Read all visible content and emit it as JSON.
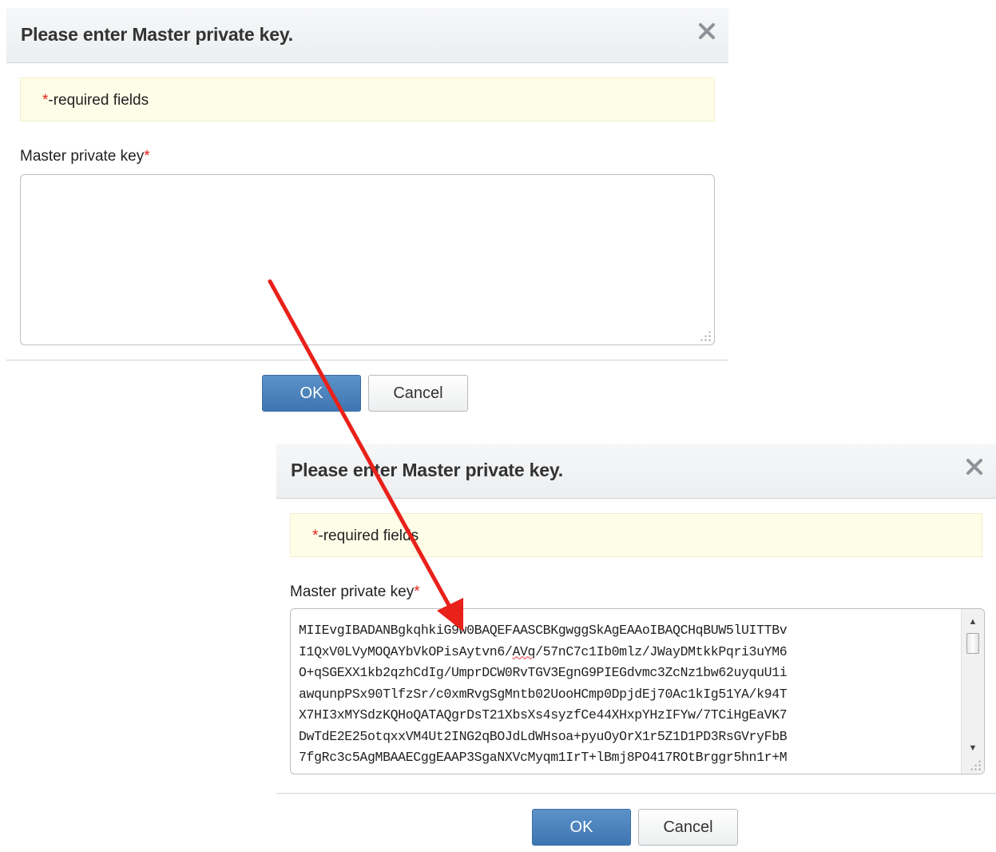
{
  "dialog_top": {
    "title": "Please enter Master private key.",
    "required_star": "*",
    "required_text": "-required fields",
    "field_label": "Master private key",
    "field_star": "*",
    "key_value": "",
    "ok_label": "OK",
    "cancel_label": "Cancel",
    "close_icon": "close-icon"
  },
  "dialog_bottom": {
    "title": "Please enter Master private key.",
    "required_star": "*",
    "required_text": "-required fields",
    "field_label": "Master private key",
    "field_star": "*",
    "key_lines": [
      "MIIEvgIBADANBgkqhkiG9w0BAQEFAASCBKgwggSkAgEAAoIBAQCHqBUW5lUITTBv",
      "I1QxV0LVyMOQAYbVkOPisAytvn6/",
      "AVq",
      "/57nC7c1Ib0mlz/JWayDMtkkPqri3uYM6",
      "O+qSGEXX1kb2qzhCdIg/UmprDCW0RvTGV3EgnG9PIEGdvmc3ZcNz1bw62uyquU1i",
      "awqunpPSx90TlfzSr/c0xmRvgSgMntb02UooHCmp0DpjdEj70Ac1kIg51YA/k94T",
      "X7HI3xMYSdzKQHoQATAQgrDsT21XbsXs4syzfCe44XHxpYHzIFYw/7TCiHgEaVK7",
      "DwTdE2E25otqxxVM4Ut2ING2qBOJdLdWHsoa+pyuOyOrX1r5Z1D1PD3RsGVryFbB",
      "7fgRc3c5AgMBAAECggEAAP3SgaNXVcMyqm1IrT+lBmj8PO417ROtBrggr5hn1r+M"
    ],
    "ok_label": "OK",
    "cancel_label": "Cancel",
    "close_icon": "close-icon",
    "scroll_up_icon": "scroll-up-arrow-icon",
    "scroll_down_icon": "scroll-down-arrow-icon"
  },
  "annotation": {
    "arrow_icon": "red-arrow-icon",
    "arrow_color": "#e8211a"
  },
  "colors": {
    "required_star": "#e0251b",
    "ok_button": "#4a82bf",
    "notice_background": "#fefde8"
  }
}
